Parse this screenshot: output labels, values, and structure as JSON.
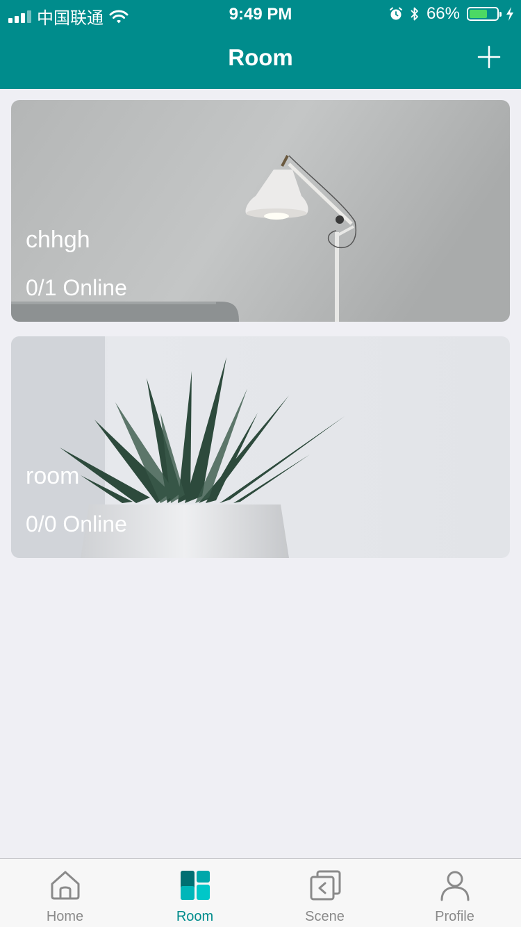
{
  "status_bar": {
    "carrier": "中国联通",
    "time": "9:49 PM",
    "battery_percent": "66%",
    "battery_level": 0.66,
    "battery_color": "#4cd964"
  },
  "nav": {
    "title": "Room",
    "add_icon": "plus-icon"
  },
  "rooms": [
    {
      "name": "chhgh",
      "status": "0/1 Online",
      "background": "floor-lamp-photo"
    },
    {
      "name": "room",
      "status": "0/0 Online",
      "background": "succulent-plant-photo"
    }
  ],
  "tabs": [
    {
      "label": "Home",
      "icon": "home-icon",
      "active": false
    },
    {
      "label": "Room",
      "icon": "room-icon",
      "active": true
    },
    {
      "label": "Scene",
      "icon": "scene-icon",
      "active": false
    },
    {
      "label": "Profile",
      "icon": "profile-icon",
      "active": false
    }
  ],
  "colors": {
    "accent": "#008c8c",
    "background": "#efeff4",
    "tab_inactive": "#8a8a8a"
  }
}
